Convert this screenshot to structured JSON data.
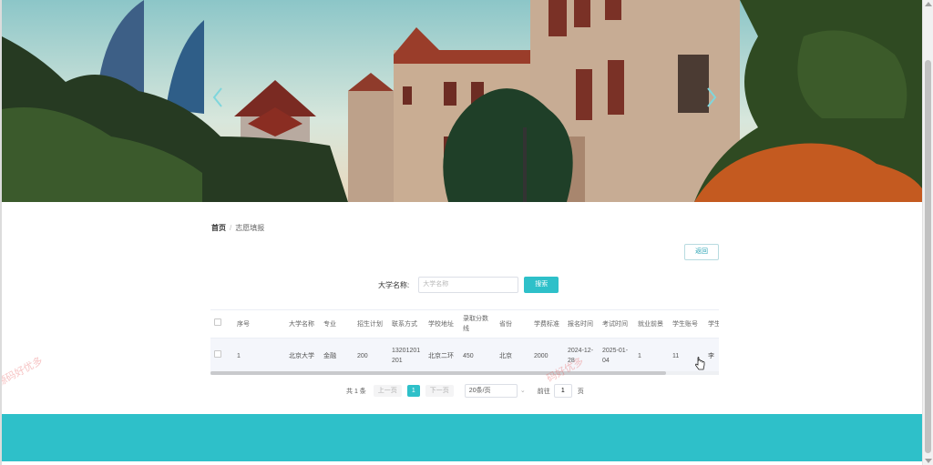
{
  "carousel": {
    "prev_icon": "chevron-left-icon",
    "next_icon": "chevron-right-icon"
  },
  "breadcrumb": {
    "home": "首页",
    "separator": "/",
    "current": "志愿填报"
  },
  "actions": {
    "back_label": "返回"
  },
  "search": {
    "label": "大学名称:",
    "placeholder": "大学名称",
    "button_label": "搜索"
  },
  "table": {
    "columns": [
      "序号",
      "大学名称",
      "专业",
      "招生计划",
      "联系方式",
      "学校地址",
      "录取分数线",
      "省份",
      "学费标准",
      "报名时间",
      "考试时间",
      "就业前景",
      "学生账号",
      "学生名"
    ],
    "rows": [
      [
        "1",
        "北京大学",
        "金融",
        "200",
        "13201201201",
        "北京二环",
        "450",
        "北京",
        "2000",
        "2024-12-28",
        "2025-01-04",
        "1",
        "11",
        "李"
      ]
    ]
  },
  "pagination": {
    "total": "共 1 条",
    "prev": "上一页",
    "current_page": "1",
    "next": "下一页",
    "page_size": "20条/页",
    "goto_label": "前往",
    "goto_value": "1",
    "goto_unit": "页"
  },
  "watermarks": [
    "源码好优多",
    "码好优多"
  ],
  "colors": {
    "accent": "#2ec0c9",
    "footer": "#2ec0c9"
  }
}
